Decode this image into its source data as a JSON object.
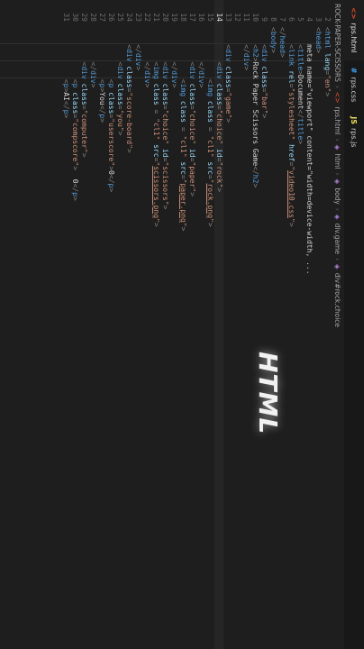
{
  "tabs": [
    {
      "label": "rps.html",
      "icon": "html-file-icon",
      "active": true
    },
    {
      "label": "rps.css",
      "icon": "css-file-icon",
      "active": false
    },
    {
      "label": "rps.js",
      "icon": "js-file-icon",
      "active": false
    }
  ],
  "breadcrumbs": [
    "ROCK-PAPER-SCISSORS",
    "rps.html",
    "html",
    "body",
    "div.game",
    "div#rock.choice"
  ],
  "line_numbers": [
    "2",
    "3",
    "4",
    "5",
    "6",
    "7",
    "8",
    "9",
    "10",
    "11",
    "12",
    "13",
    "14",
    "15",
    "16",
    "17",
    "18",
    "19",
    "20",
    "21",
    "22",
    "23",
    "24",
    "25",
    "26",
    "27",
    "28",
    "29",
    "30",
    "31"
  ],
  "current_line": "14",
  "code_lines": [
    "<html lang=\"en\">",
    "<head>",
    "    <meta name=\"viewport\" content=\"width=device-width, ...",
    "    <title>Document</title>",
    "    <link rel=\"stylesheet\" href=\"video10.css\">",
    "</head>",
    "<body>",
    "    <div class=\"bar\">",
    "    <h2>Rock Paper Scissors Game</h2>",
    "    </div>",
    "",
    "    <div class=\"game\">",
    "        <div class=\"choice\" id=\"rock\">",
    "            <img class = \"cl1\" src=\"rock.png\">",
    "        </div>",
    "        <div class=\"choice\" id=\"paper\">",
    "            <img class = \"cl1\" src=\"paper.png\">",
    "        </div>",
    "        <div class=\"choice\" id=\"scissors\">",
    "        <img class = \"cl1\" src=\"scissors.png\">",
    "        </div>",
    "    </div>",
    "    <div class=\"score-board\">",
    "        <div class=\"you\">",
    "            <p class=\"userscore\">0</p>",
    "            <p>You</p>",
    "        </div>",
    "        <div class=\"computer\">",
    "            <p class=\"compscore\">  0</p>",
    "            <p>AI</p>"
  ],
  "overlay_text": "HTML",
  "colors": {
    "tag": "#569cd6",
    "attr": "#9cdcfe",
    "string": "#ce9178",
    "punct": "#808080",
    "background": "#1e1e1e"
  }
}
